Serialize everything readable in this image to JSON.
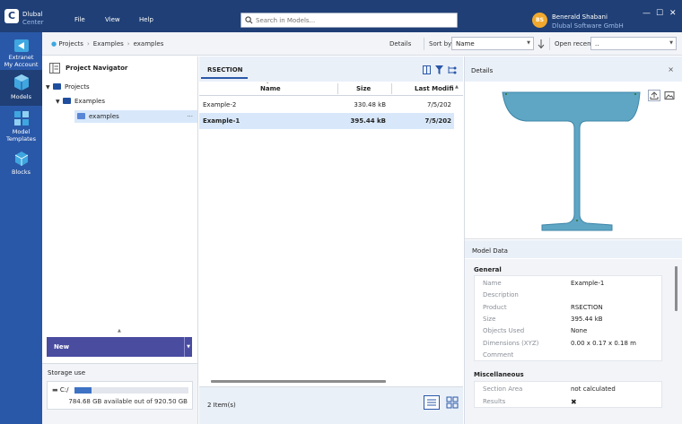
{
  "app": {
    "name": "Dlubal",
    "sub": "Center",
    "logo_letter": "C"
  },
  "menu": [
    "File",
    "View",
    "Help"
  ],
  "search": {
    "placeholder": "Search in Models..."
  },
  "user": {
    "initials": "BS",
    "name": "Benerald Shabani",
    "company": "Dlubal Software GmbH"
  },
  "window_controls": {
    "minimize": "—",
    "maximize": "☐",
    "close": "✕"
  },
  "sidebar": {
    "items": [
      {
        "label": "Extranet",
        "label2": "My Account",
        "icon": "extranet-icon"
      },
      {
        "label": "Models",
        "icon": "models-icon"
      },
      {
        "label": "Model",
        "label2": "Templates",
        "icon": "templates-icon"
      },
      {
        "label": "Blocks",
        "icon": "blocks-icon"
      }
    ]
  },
  "toolbar": {
    "breadcrumb": [
      "Projects",
      "Examples",
      "examples"
    ],
    "details_label": "Details",
    "details_on": true,
    "sort_label": "Sort by",
    "sort_value": "Name",
    "open_recent_label": "Open recent",
    "open_recent_value": ".."
  },
  "navigator": {
    "title": "Project Navigator",
    "tree": [
      {
        "label": "Projects",
        "level": 0,
        "expanded": true
      },
      {
        "label": "Examples",
        "level": 1,
        "expanded": true
      },
      {
        "label": "examples",
        "level": 2,
        "selected": true,
        "more": "···"
      }
    ],
    "new_button": "New",
    "splitter_glyph": "▲"
  },
  "storage": {
    "title": "Storage use",
    "drive": "C:/",
    "used_fraction": 0.15,
    "available_text": "784.68 GB available out of 920.50 GB"
  },
  "center": {
    "title": "RSECTION",
    "columns": [
      "Name",
      "Size",
      "Last Modified"
    ],
    "rows": [
      {
        "name": "Example-2",
        "size": "330.48 kB",
        "modified": "7/5/202",
        "selected": false
      },
      {
        "name": "Example-1",
        "size": "395.44 kB",
        "modified": "7/5/202",
        "selected": true
      }
    ],
    "items_count": "2 Item(s)"
  },
  "details": {
    "title": "Details",
    "close": "×",
    "model_data_title": "Model Data",
    "general_title": "General",
    "general": [
      {
        "key": "Name",
        "value": "Example-1"
      },
      {
        "key": "Description",
        "value": ""
      },
      {
        "key": "Product",
        "value": "RSECTION"
      },
      {
        "key": "Size",
        "value": "395.44 kB"
      },
      {
        "key": "Objects Used",
        "value": "None"
      },
      {
        "key": "Dimensions (XYZ)",
        "value": "0.00 x 0.17 x 0.18 m"
      },
      {
        "key": "Comment",
        "value": ""
      }
    ],
    "misc_title": "Miscellaneous",
    "misc": [
      {
        "key": "Section Area",
        "value": "not calculated"
      },
      {
        "key": "Results",
        "value": "✖"
      }
    ]
  },
  "colors": {
    "title_bar": "#1f3f76",
    "sidebar": "#2a58a8",
    "new_button": "#4a4ca0",
    "accent": "#2a58a8",
    "toggle_on": "#1e9e5a",
    "avatar": "#f0a92e",
    "section_fill": "#5fa6c4"
  }
}
